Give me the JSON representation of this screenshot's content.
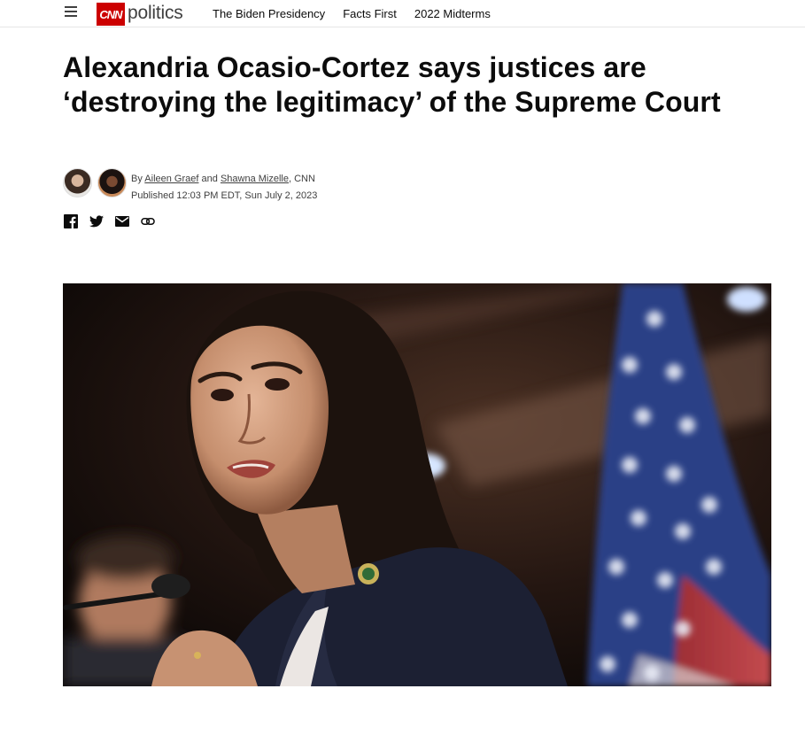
{
  "header": {
    "logo": {
      "brand": "CNN",
      "section": "politics"
    },
    "nav": [
      {
        "label": "The Biden Presidency"
      },
      {
        "label": "Facts First"
      },
      {
        "label": "2022 Midterms"
      }
    ]
  },
  "article": {
    "headline": "Alexandria Ocasio-Cortez says justices are ‘destroying the legitimacy’ of the Supreme Court",
    "byline": {
      "prefix": "By",
      "authors": [
        "Aileen Graef",
        "Shawna Mizelle"
      ],
      "joiner": "and",
      "outlet": ", CNN",
      "published": "Published 12:03 PM EDT, Sun July 2, 2023"
    },
    "share_icons": [
      "facebook-icon",
      "twitter-icon",
      "email-icon",
      "link-icon"
    ]
  },
  "colors": {
    "brand_red": "#cc0000",
    "text": "#0c0c0c",
    "muted": "#404040"
  }
}
